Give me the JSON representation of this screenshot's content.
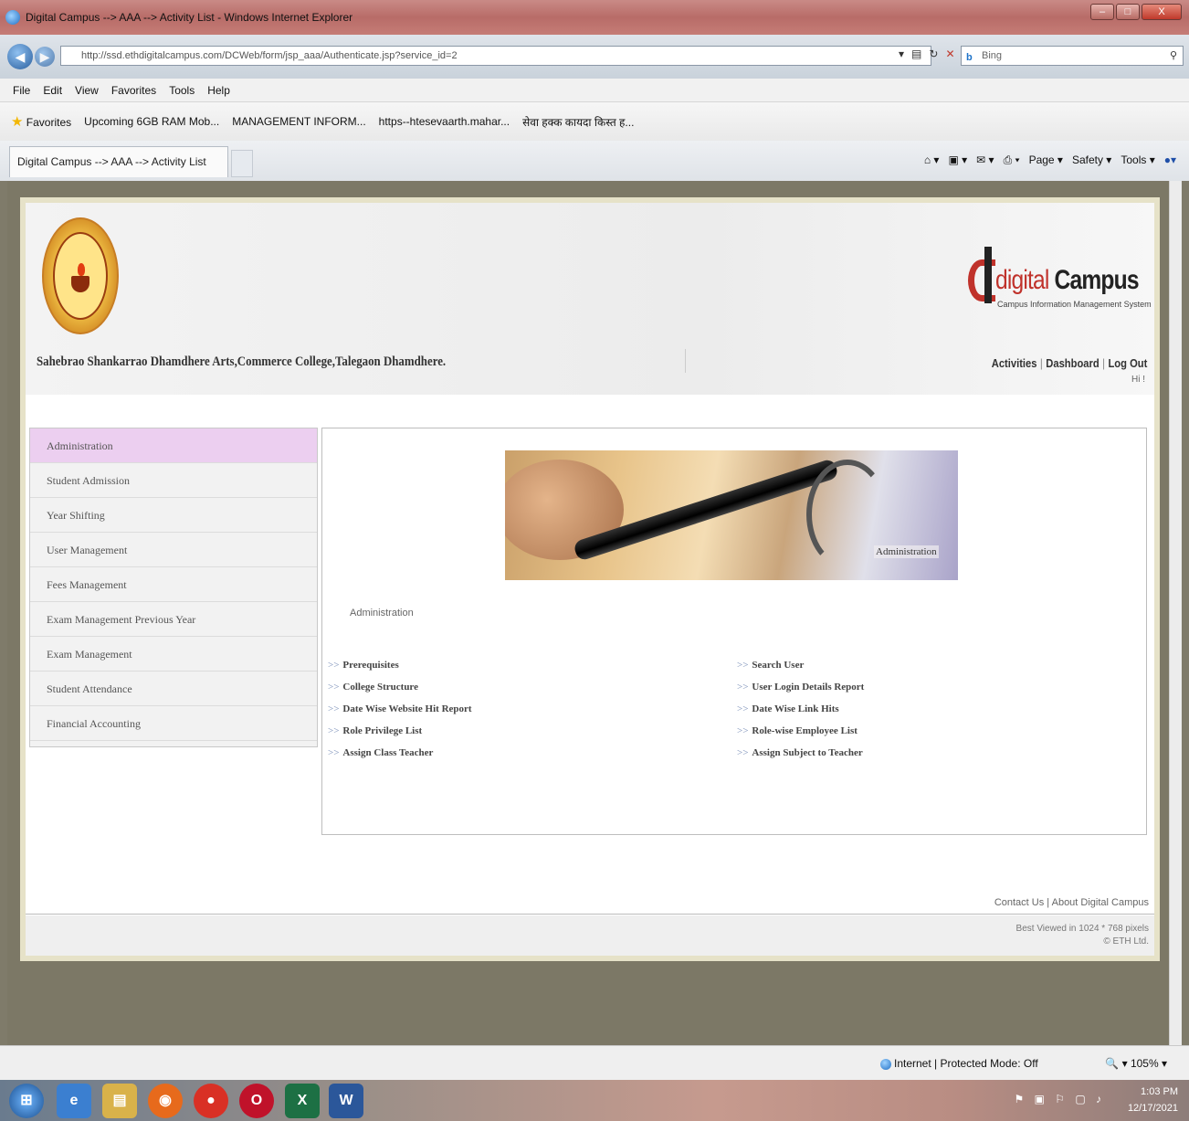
{
  "window": {
    "title": "Digital Campus --> AAA --> Activity List - Windows Internet Explorer",
    "controls": [
      "–",
      "□",
      "X"
    ]
  },
  "addressbar": {
    "url": "http://ssd.ethdigitalcampus.com/DCWeb/form/jsp_aaa/Authenticate.jsp?service_id=2",
    "search_placeholder": "Bing",
    "search_engine_icon": "b"
  },
  "menubar": {
    "items": [
      "File",
      "Edit",
      "View",
      "Favorites",
      "Tools",
      "Help"
    ]
  },
  "favorites": {
    "label": "Favorites",
    "items": [
      "Upcoming 6GB RAM Mob...",
      "MANAGEMENT INFORM...",
      "https--htesevaarth.mahar...",
      "सेवा हक्क कायदा किस्त ह..."
    ]
  },
  "tabs": {
    "active": "Digital Campus --> AAA --> Activity List"
  },
  "commandbar": {
    "items": [
      "Page ▾",
      "Safety ▾",
      "Tools ▾"
    ]
  },
  "header": {
    "college_name": "Sahebrao Shankarrao Dhamdhere Arts,Commerce College,Talegaon Dhamdhere.",
    "brand_part1": "digital",
    "brand_part2": "Campus",
    "tagline": "Campus Information Management System",
    "top_links": [
      "Activities",
      "Dashboard",
      "Log Out"
    ],
    "hi_text": "Hi !"
  },
  "sidebar": {
    "items": [
      {
        "label": "Administration",
        "active": true
      },
      {
        "label": "Student Admission",
        "active": false
      },
      {
        "label": "Year Shifting",
        "active": false
      },
      {
        "label": "User Management",
        "active": false
      },
      {
        "label": "Fees Management",
        "active": false
      },
      {
        "label": "Exam Management Previous Year",
        "active": false
      },
      {
        "label": "Exam Management",
        "active": false
      },
      {
        "label": "Student Attendance",
        "active": false
      },
      {
        "label": "Financial Accounting",
        "active": false
      }
    ]
  },
  "content": {
    "banner_label": "Administration",
    "title": "Administration",
    "arrow": ">>",
    "left_links": [
      "Prerequisites",
      "College Structure",
      "Date Wise Website Hit Report",
      "Role Privilege List",
      "Assign Class Teacher"
    ],
    "right_links": [
      "Search User",
      "User Login Details Report",
      "Date Wise Link Hits",
      "Role-wise Employee List",
      "Assign Subject to Teacher"
    ]
  },
  "footer": {
    "contact": "Contact Us",
    "about": "About Digital Campus",
    "best_viewed": "Best Viewed in 1024 * 768 pixels",
    "copyright": "© ETH Ltd."
  },
  "statusbar": {
    "zone": "Internet | Protected Mode: Off",
    "zoom": "105%"
  },
  "taskbar": {
    "time": "1:03 PM",
    "date": "12/17/2021"
  }
}
